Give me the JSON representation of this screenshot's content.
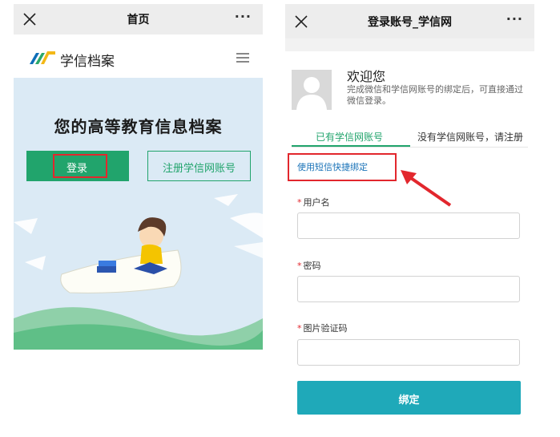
{
  "left_screen": {
    "navbar": {
      "title": "首页",
      "close_icon": "close-icon",
      "more_icon": "more-dots-icon",
      "more_label": "···"
    },
    "header": {
      "logo_text": "学信档案",
      "logo_icon": "xuexin-logo-icon",
      "menu_icon": "hamburger-menu-icon"
    },
    "hero": {
      "title": "您的高等教育信息档案",
      "login_label": "登录",
      "register_label": "注册学信网账号"
    }
  },
  "right_screen": {
    "navbar": {
      "title": "登录账号_学信网",
      "close_icon": "close-icon",
      "more_label": "···"
    },
    "welcome": {
      "title": "欢迎您",
      "description": "完成微信和学信网账号的绑定后，可直接通过微信登录。"
    },
    "tabs": [
      {
        "label": "已有学信网账号",
        "active": true
      },
      {
        "label": "没有学信网账号，请注册",
        "active": false
      }
    ],
    "sms_link": "使用短信快捷绑定",
    "fields": [
      {
        "required_mark": "*",
        "label": "用户名",
        "value": ""
      },
      {
        "required_mark": "*",
        "label": "密码",
        "value": ""
      },
      {
        "required_mark": "*",
        "label": "图片验证码",
        "value": ""
      }
    ],
    "bind_label": "绑定"
  },
  "colors": {
    "brand_green": "#21a46c",
    "bind_teal": "#1fa9b9",
    "highlight_red": "#e2272d",
    "link_blue": "#1a73b8"
  }
}
